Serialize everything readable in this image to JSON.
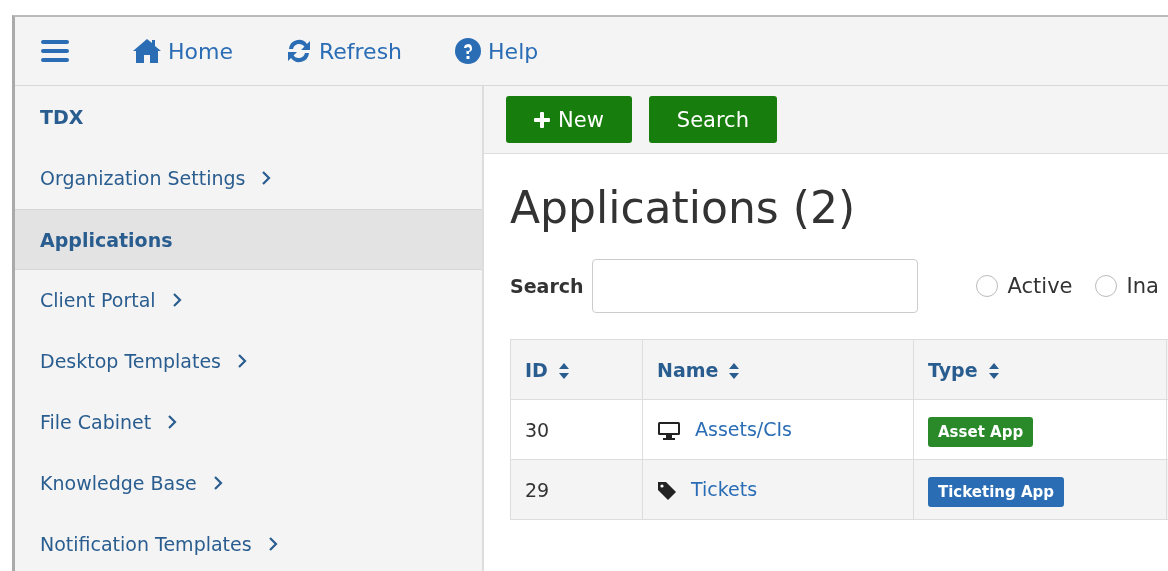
{
  "topbar": {
    "items": [
      {
        "kind": "menu"
      },
      {
        "kind": "home",
        "label": "Home"
      },
      {
        "kind": "refresh",
        "label": "Refresh"
      },
      {
        "kind": "help",
        "label": "Help"
      }
    ]
  },
  "sidebar": {
    "title": "TDX",
    "items": [
      {
        "label": "Organization Settings",
        "selected": false,
        "expandable": true
      },
      {
        "label": "Applications",
        "selected": true,
        "expandable": false
      },
      {
        "label": "Client Portal",
        "selected": false,
        "expandable": true
      },
      {
        "label": "Desktop Templates",
        "selected": false,
        "expandable": true
      },
      {
        "label": "File Cabinet",
        "selected": false,
        "expandable": true
      },
      {
        "label": "Knowledge Base",
        "selected": false,
        "expandable": true
      },
      {
        "label": "Notification Templates",
        "selected": false,
        "expandable": true
      }
    ]
  },
  "toolbar": {
    "buttons": [
      {
        "kind": "new",
        "label": "New"
      },
      {
        "kind": "search",
        "label": "Search"
      }
    ]
  },
  "heading": "Applications (2)",
  "filter": {
    "label": "Search",
    "radios": [
      {
        "label": "Active",
        "selected": false
      },
      {
        "label": "Ina",
        "selected": false
      }
    ]
  },
  "table": {
    "columns": [
      {
        "label": "ID",
        "sortable": true
      },
      {
        "label": "Name",
        "sortable": true
      },
      {
        "label": "Type",
        "sortable": true
      }
    ],
    "rows": [
      {
        "id": "30",
        "kind": "asset",
        "name": "Assets/CIs",
        "type": {
          "label": "Asset App",
          "color": "#2a8a2a"
        }
      },
      {
        "id": "29",
        "kind": "ticket",
        "name": "Tickets",
        "type": {
          "label": "Ticketing App",
          "color": "#2a6db5"
        }
      }
    ]
  }
}
